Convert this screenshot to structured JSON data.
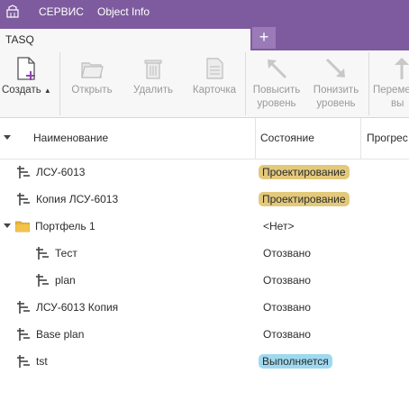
{
  "menubar": {
    "items": [
      "СЕРВИС",
      "Object Info"
    ]
  },
  "tab": {
    "label": "TASQ",
    "add": "+"
  },
  "toolbar": {
    "create": "Создать",
    "open": "Открыть",
    "delete": "Удалить",
    "card": "Карточка",
    "raise_1": "Повысить",
    "raise_2": "уровень",
    "lower_1": "Понизить",
    "lower_2": "уровень",
    "move_1": "Переме",
    "move_2": "вы"
  },
  "columns": {
    "name": "Наименование",
    "state": "Состояние",
    "progress": "Прогрес"
  },
  "rows": [
    {
      "name": "ЛСУ-6013",
      "state": "Проектирование",
      "status": "design",
      "type": "plan",
      "level": 0
    },
    {
      "name": "Копия ЛСУ-6013",
      "state": "Проектирование",
      "status": "design",
      "type": "plan",
      "level": 0
    },
    {
      "name": "Портфель 1",
      "state": "<Нет>",
      "status": "none",
      "type": "folder",
      "level": 0,
      "expanded": true
    },
    {
      "name": "Тест",
      "state": "Отозвано",
      "status": "none",
      "type": "plan",
      "level": 1
    },
    {
      "name": "plan",
      "state": "Отозвано",
      "status": "none",
      "type": "plan",
      "level": 1
    },
    {
      "name": "ЛСУ-6013 Копия",
      "state": "Отозвано",
      "status": "none",
      "type": "plan",
      "level": 0
    },
    {
      "name": "Base plan",
      "state": "Отозвано",
      "status": "none",
      "type": "plan",
      "level": 0
    },
    {
      "name": "tst",
      "state": "Выполняется",
      "status": "running",
      "type": "plan",
      "level": 0
    }
  ],
  "colors": {
    "accent": "#7e5b9e",
    "badge_design": "#e3c97b",
    "badge_running": "#9fd9ef"
  }
}
